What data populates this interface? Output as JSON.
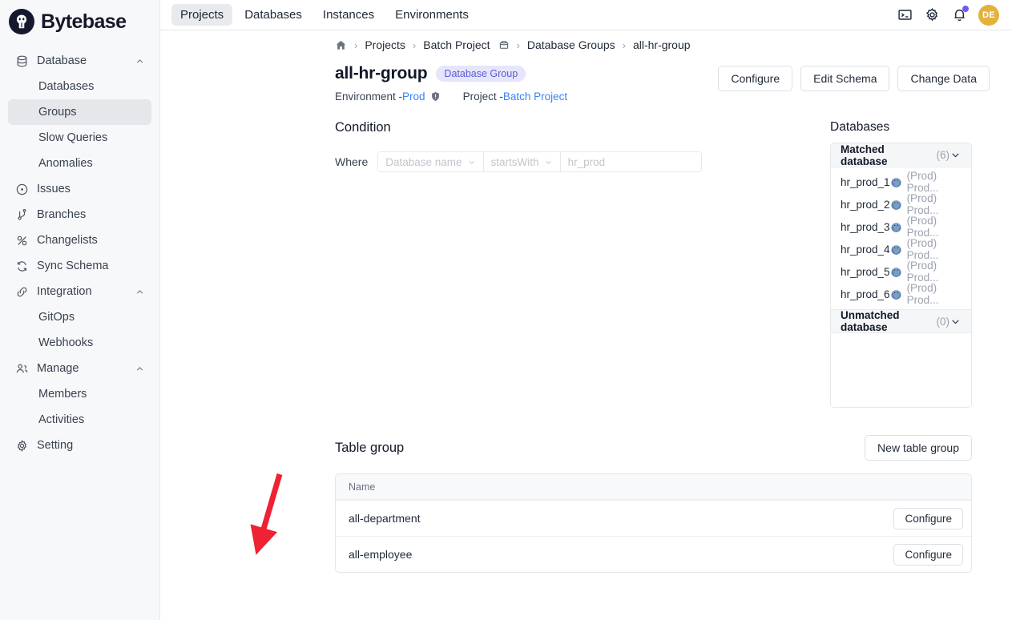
{
  "brand": {
    "name": "Bytebase"
  },
  "sidebar": {
    "groups": [
      {
        "label": "Database",
        "icon": "database-icon",
        "expanded": true,
        "children": [
          {
            "label": "Databases",
            "active": false
          },
          {
            "label": "Groups",
            "active": true
          },
          {
            "label": "Slow Queries",
            "active": false
          },
          {
            "label": "Anomalies",
            "active": false
          }
        ]
      },
      {
        "label": "Issues",
        "icon": "issues-icon",
        "children": []
      },
      {
        "label": "Branches",
        "icon": "branches-icon",
        "children": []
      },
      {
        "label": "Changelists",
        "icon": "changelists-icon",
        "children": []
      },
      {
        "label": "Sync Schema",
        "icon": "sync-icon",
        "children": []
      },
      {
        "label": "Integration",
        "icon": "link-icon",
        "expanded": true,
        "children": [
          {
            "label": "GitOps",
            "active": false
          },
          {
            "label": "Webhooks",
            "active": false
          }
        ]
      },
      {
        "label": "Manage",
        "icon": "people-icon",
        "expanded": true,
        "children": [
          {
            "label": "Members",
            "active": false
          },
          {
            "label": "Activities",
            "active": false
          }
        ]
      },
      {
        "label": "Setting",
        "icon": "gear-icon",
        "children": []
      }
    ]
  },
  "topbar": {
    "tabs": [
      {
        "label": "Projects",
        "active": true
      },
      {
        "label": "Databases",
        "active": false
      },
      {
        "label": "Instances",
        "active": false
      },
      {
        "label": "Environments",
        "active": false
      }
    ],
    "icons": [
      "terminal-icon",
      "gear-icon",
      "bell-icon"
    ],
    "avatar_initials": "DE",
    "avatar_color": "#e3b23c",
    "notification_dot_color": "#6d5bf7"
  },
  "breadcrumb": {
    "home_icon": "home-icon",
    "separator": "›",
    "items": [
      {
        "label": "Projects",
        "icon": null
      },
      {
        "label": "Batch Project",
        "icon": "box-icon"
      },
      {
        "label": "Database Groups",
        "icon": null
      },
      {
        "label": "all-hr-group",
        "icon": null
      }
    ]
  },
  "header": {
    "title": "all-hr-group",
    "badge": "Database Group",
    "badge_bg": "#e5e5fb",
    "badge_fg": "#5b5bd6",
    "environment_label": "Environment - ",
    "environment_value": "Prod",
    "environment_icon": "shield-icon",
    "project_label": "Project - ",
    "project_value": "Batch Project",
    "actions": [
      {
        "label": "Configure"
      },
      {
        "label": "Edit Schema"
      },
      {
        "label": "Change Data"
      }
    ]
  },
  "condition": {
    "heading": "Condition",
    "where_label": "Where",
    "field": "Database name",
    "operator": "startsWith",
    "value": "hr_prod"
  },
  "databases": {
    "heading": "Databases",
    "matched": {
      "title": "Matched database",
      "count": "(6)",
      "rows": [
        {
          "name": "hr_prod_1",
          "engine_icon": "postgres-icon",
          "env": "(Prod) Prod..."
        },
        {
          "name": "hr_prod_2",
          "engine_icon": "postgres-icon",
          "env": "(Prod) Prod..."
        },
        {
          "name": "hr_prod_3",
          "engine_icon": "postgres-icon",
          "env": "(Prod) Prod..."
        },
        {
          "name": "hr_prod_4",
          "engine_icon": "postgres-icon",
          "env": "(Prod) Prod..."
        },
        {
          "name": "hr_prod_5",
          "engine_icon": "postgres-icon",
          "env": "(Prod) Prod..."
        },
        {
          "name": "hr_prod_6",
          "engine_icon": "postgres-icon",
          "env": "(Prod) Prod..."
        }
      ]
    },
    "unmatched": {
      "title": "Unmatched database",
      "count": "(0)",
      "rows": []
    }
  },
  "table_group": {
    "heading": "Table group",
    "new_button": "New table group",
    "column_header": "Name",
    "rows": [
      {
        "name": "all-department",
        "action": "Configure"
      },
      {
        "name": "all-employee",
        "action": "Configure"
      }
    ]
  },
  "annotation": {
    "arrow_color": "#ee2233",
    "points_to": "all-department"
  }
}
